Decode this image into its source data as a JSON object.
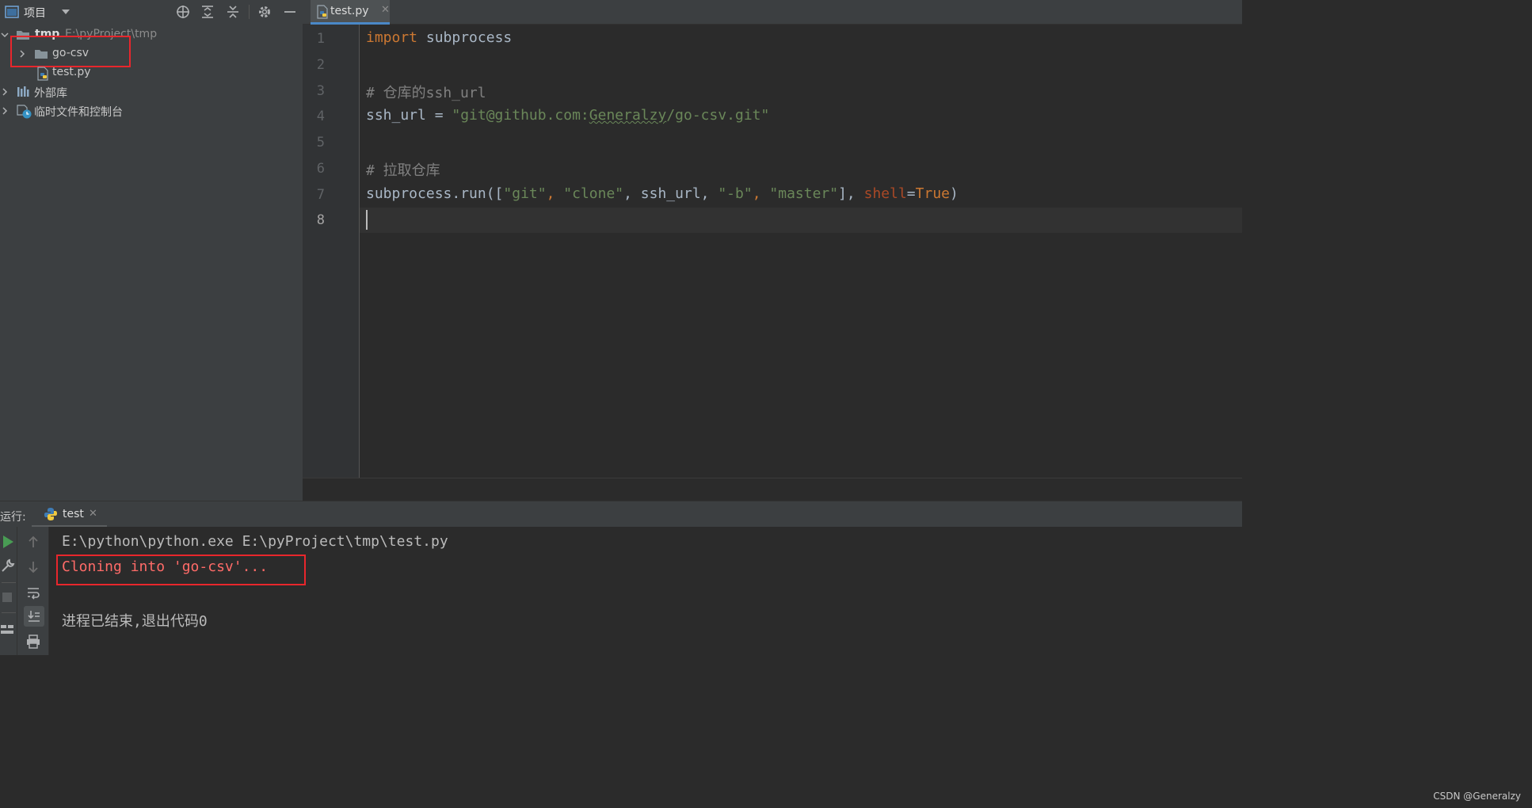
{
  "project": {
    "title": "项目",
    "root_name": "tmp",
    "root_path": "E:\\pyProject\\tmp",
    "items": [
      {
        "label": "go-csv"
      },
      {
        "label": "test.py"
      },
      {
        "label": "外部库"
      },
      {
        "label": "临时文件和控制台"
      }
    ]
  },
  "editor": {
    "tab_label": "test.py",
    "tab_close": "✕",
    "line_numbers": [
      "1",
      "2",
      "3",
      "4",
      "5",
      "6",
      "7",
      "8"
    ],
    "code": {
      "l1_kw": "import",
      "l1_rest": " subprocess",
      "l3": "# 仓库的ssh_url",
      "l4_var": "ssh_url = ",
      "l4_q1": "\"git@github.com:",
      "l4_user": "Generalzy",
      "l4_q2": "/go-csv.git\"",
      "l6": "# 拉取仓库",
      "l7_a": "subprocess.run([",
      "l7_s1": "\"git\"",
      "l7_c1": ", ",
      "l7_s2": "\"clone\"",
      "l7_c2": ", ssh_url, ",
      "l7_s3": "\"-b\"",
      "l7_c3": ", ",
      "l7_s4": "\"master\"",
      "l7_c4": "], ",
      "l7_kw": "shell",
      "l7_eq": "=",
      "l7_true": "True",
      "l7_end": ")"
    }
  },
  "run": {
    "label": "运行:",
    "tab_label": "test",
    "tab_close": "✕",
    "console": {
      "command": "E:\\python\\python.exe E:\\pyProject\\tmp\\test.py",
      "output": "Cloning into 'go-csv'...",
      "exit": "进程已结束,退出代码0"
    }
  },
  "watermark": "CSDN @Generalzy",
  "colors": {
    "panel_bg": "#3c3f41",
    "editor_bg": "#2b2b2b",
    "keyword": "#cc7832",
    "string": "#6a8759",
    "comment": "#808080",
    "stderr": "#ff6b68",
    "highlight_box": "#e8262c"
  }
}
